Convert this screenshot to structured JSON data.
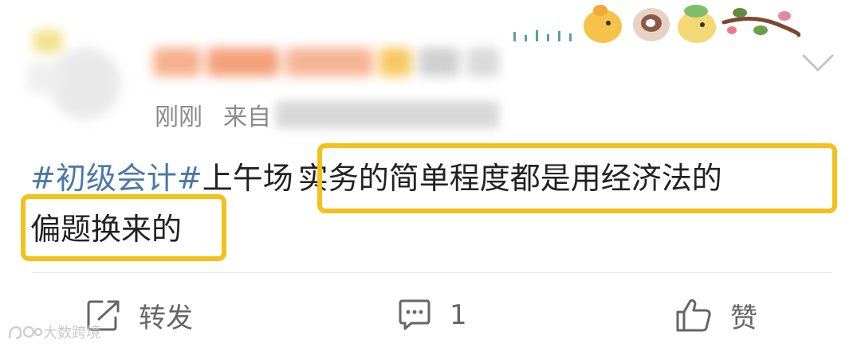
{
  "post": {
    "timestamp": "刚刚",
    "source_prefix": "来自",
    "topic": "#初级会计#",
    "text_before_highlight": "上午场",
    "highlight_line1": "实务的简单程度都是用经济法的",
    "highlight_line2": "偏题换来的"
  },
  "actions": {
    "repost_label": "转发",
    "comment_count": "1",
    "like_label": "赞"
  },
  "watermark": {
    "text": "大数跨境"
  },
  "colors": {
    "topic": "#4a78a8",
    "highlight_border": "#f2c21a",
    "meta_text": "#8a8a8a",
    "action_text": "#666666"
  }
}
